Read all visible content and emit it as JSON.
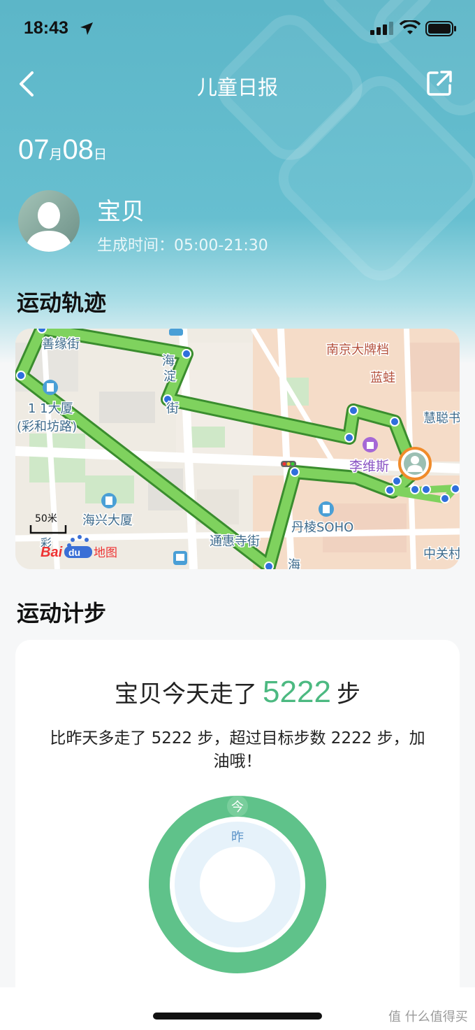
{
  "status_bar": {
    "time": "18:43"
  },
  "nav": {
    "title": "儿童日报"
  },
  "date": {
    "month": "07",
    "month_unit": "月",
    "day": "08",
    "day_unit": "日"
  },
  "child": {
    "name": "宝贝",
    "gen_time": "生成时间：05:00-21:30"
  },
  "sections": {
    "track": "运动轨迹",
    "steps": "运动计步"
  },
  "map": {
    "labels": {
      "shanyuan": "善缘街",
      "nanjing": "南京大牌档",
      "lanwa": "蓝蛙",
      "huicong": "慧聪书",
      "lixiang": "1 1大厦",
      "caihe": "(彩和坊路)",
      "hai": "海",
      "dian": "淀",
      "jie": "街",
      "livisi": "李维斯",
      "haixing": "海兴大厦",
      "danling": "丹棱SOHO",
      "tongsi": "通惠寺街",
      "zhongguan": "中关村",
      "cai": "彩",
      "hai2": "海",
      "scale": "50米",
      "baidu": "Bai",
      "baidu_du": "du",
      "baidu_map": "地图"
    }
  },
  "steps": {
    "prefix": "宝贝今天走了",
    "count": "5222",
    "suffix": "步",
    "desc": "比昨天多走了 5222 步，超过目标步数 2222 步，加油哦！",
    "today_label": "今",
    "yesterday_label": "昨",
    "today_color": "#5fc28a",
    "yesterday_color": "#e6f2fa"
  },
  "watermark": "值 什么值得买"
}
